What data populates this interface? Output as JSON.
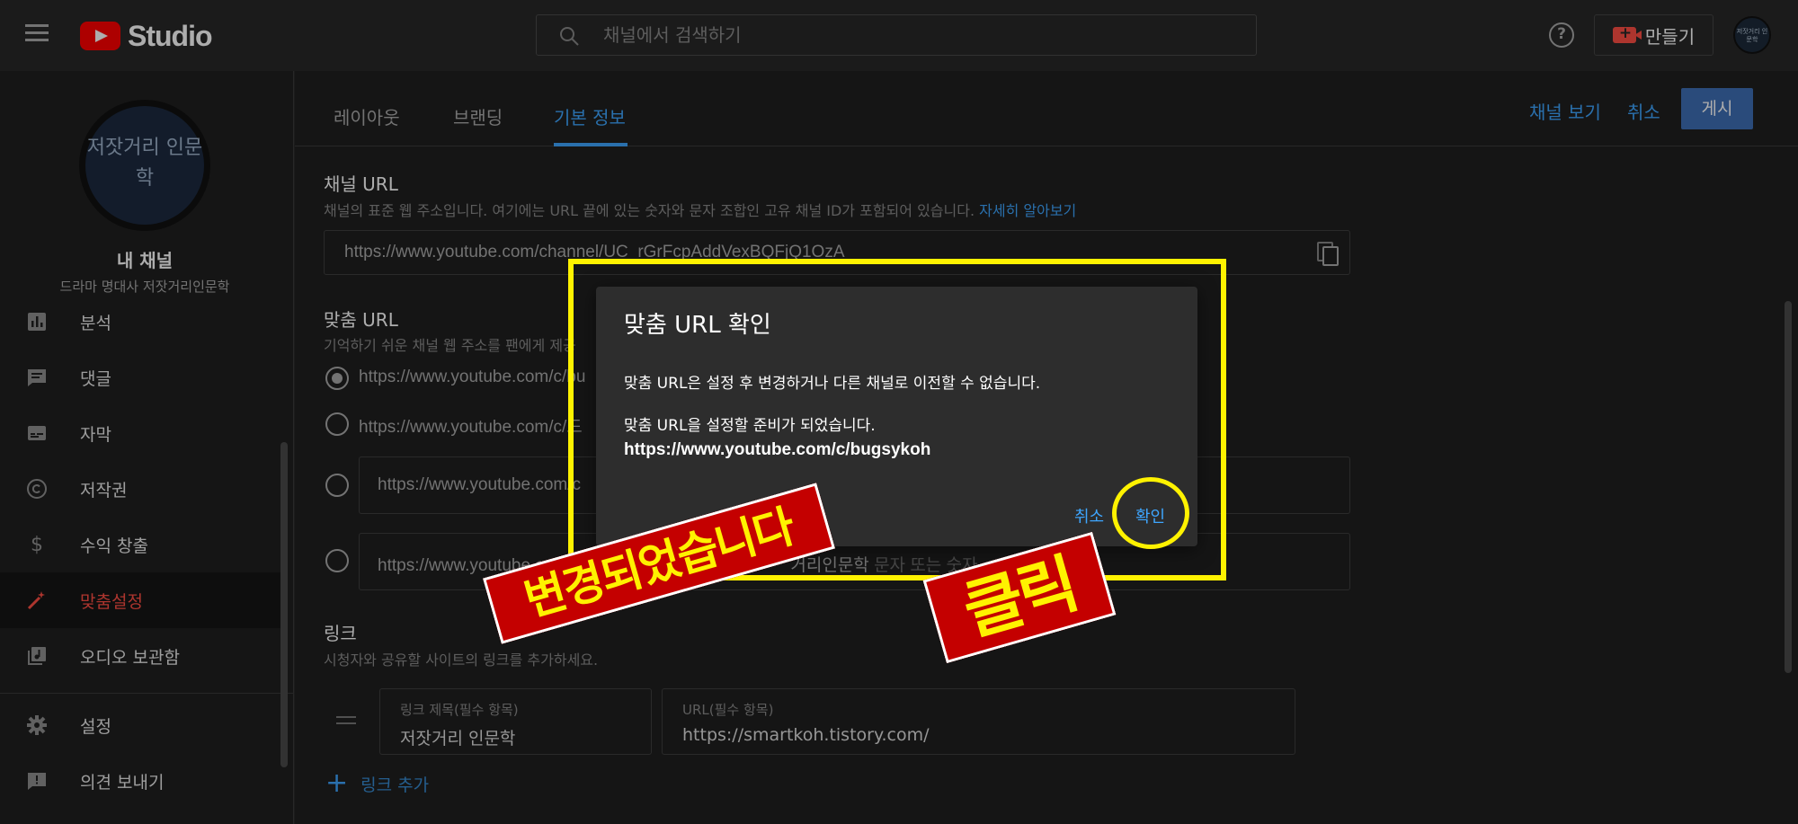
{
  "topbar": {
    "logo_text": "Studio",
    "search_placeholder": "채널에서 검색하기",
    "help_glyph": "?",
    "create_label": "만들기",
    "avatar_text": "저잣거리 인문학"
  },
  "sidebar": {
    "avatar_text": "저잣거리 인문학",
    "my_channel": "내 채널",
    "channel_name": "드라마 명대사 저잣거리인문학",
    "items": [
      {
        "label": "분석",
        "icon": "analytics-icon",
        "active": false
      },
      {
        "label": "댓글",
        "icon": "comments-icon",
        "active": false
      },
      {
        "label": "자막",
        "icon": "subtitles-icon",
        "active": false
      },
      {
        "label": "저작권",
        "icon": "copyright-icon",
        "active": false
      },
      {
        "label": "수익 창출",
        "icon": "dollar-icon",
        "active": false
      },
      {
        "label": "맞춤설정",
        "icon": "magic-wand-icon",
        "active": true
      },
      {
        "label": "오디오 보관함",
        "icon": "audio-library-icon",
        "active": false
      }
    ],
    "bottom_items": [
      {
        "label": "설정",
        "icon": "gear-icon"
      },
      {
        "label": "의견 보내기",
        "icon": "feedback-icon"
      }
    ]
  },
  "tabs": [
    "레이아웃",
    "브랜딩",
    "기본 정보"
  ],
  "actions": {
    "view_channel": "채널 보기",
    "cancel": "취소",
    "publish": "게시"
  },
  "channel_url": {
    "title": "채널 URL",
    "desc": "채널의 표준 웹 주소입니다. 여기에는 URL 끝에 있는 숫자와 문자 조합인 고유 채널 ID가 포함되어 있습니다.",
    "learn_more": "자세히 알아보기",
    "value": "https://www.youtube.com/channel/UC_rGrFcpAddVexBQFjQ1OzA"
  },
  "custom_url": {
    "title": "맞춤 URL",
    "desc": "기억하기 쉬운 채널 웹 주소를 팬에게 제공",
    "options": [
      "https://www.youtube.com/c/bu",
      "https://www.youtube.com/c/드",
      "https://www.youtube.com/c",
      "https://www.youtube.co"
    ],
    "option4_tail": "거리인문학",
    "option4_hint": " 문자 또는 숫자"
  },
  "links": {
    "title": "링크",
    "desc": "시청자와 공유할 사이트의 링크를 추가하세요.",
    "title_label": "링크 제목(필수 항목)",
    "title_value": "저잣거리 인문학",
    "url_label": "URL(필수 항목)",
    "url_value": "https://smartkoh.tistory.com/",
    "add_label": "링크 추가"
  },
  "dialog": {
    "title": "맞춤 URL 확인",
    "line1": "맞춤 URL은 설정 후 변경하거나 다른 채널로 이전할 수 없습니다.",
    "line2": "맞춤 URL을 설정할 준비가 되었습니다.",
    "url": "https://www.youtube.com/c/bugsykoh",
    "cancel": "취소",
    "confirm": "확인"
  },
  "annotations": {
    "changed": "변경되었습니다",
    "click": "클릭"
  },
  "colors": {
    "accent": "#3ea6ff",
    "active_nav": "#ff4e45",
    "publish_bg": "#3e6fb6",
    "highlight": "#fff200",
    "stamp_red": "#c40000"
  }
}
